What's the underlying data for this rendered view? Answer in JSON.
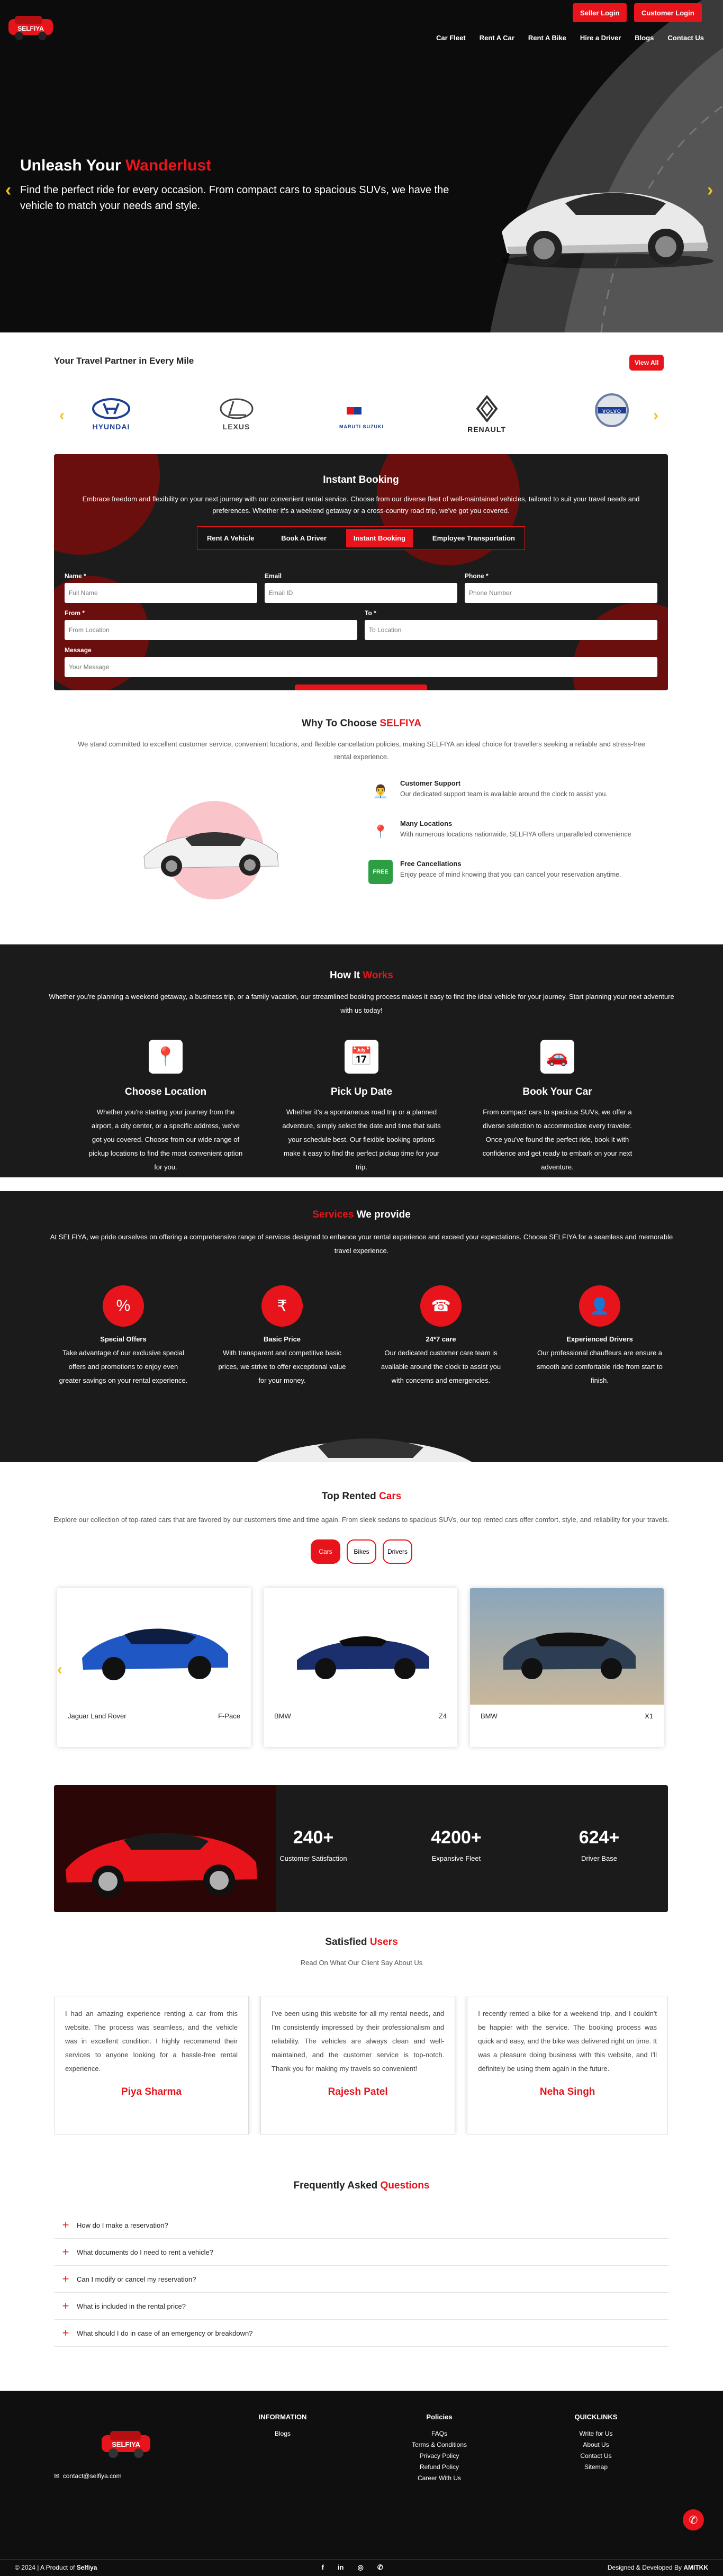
{
  "nav": {
    "seller_login": "Seller Login",
    "customer_login": "Customer Login",
    "links": [
      "Car Fleet",
      "Rent A Car",
      "Rent A Bike",
      "Hire a Driver",
      "Blogs",
      "Contact Us"
    ]
  },
  "hero": {
    "title_white": "Unleash Your",
    "title_red": "Wanderlust",
    "text": "Find the perfect ride for every occasion. From compact cars to spacious SUVs, we have the vehicle to match your needs and style."
  },
  "partners": {
    "title": "Your Travel Partner in Every Mile",
    "view_all": "View All",
    "brands": [
      "HYUNDAI",
      "LEXUS",
      "MARUTI SUZUKI",
      "RENAULT",
      "VOLVO"
    ]
  },
  "booking": {
    "title": "Instant Booking",
    "text": "Embrace freedom and flexibility on your next journey with our convenient rental service. Choose from our diverse fleet of well-maintained vehicles, tailored to suit your travel needs and preferences. Whether it's a weekend getaway or a cross-country road trip, we've got you covered.",
    "tabs": [
      "Rent A Vehicle",
      "Book A Driver",
      "Instant Booking",
      "Employee Transportation"
    ],
    "active_tab": "Instant Booking",
    "fields": {
      "name": {
        "label": "Name *",
        "placeholder": "Full Name"
      },
      "email": {
        "label": "Email",
        "placeholder": "Email ID"
      },
      "phone": {
        "label": "Phone *",
        "placeholder": "Phone Number"
      },
      "from": {
        "label": "From *",
        "placeholder": "From Location"
      },
      "to": {
        "label": "To *",
        "placeholder": "To Location"
      },
      "message": {
        "label": "Message",
        "placeholder": "Your Message"
      }
    },
    "submit": "Submit"
  },
  "why": {
    "title_black": "Why To Choose",
    "title_red": "SELFIYA",
    "text": "We stand committed to excellent customer service, convenient locations, and flexible cancellation policies, making SELFIYA an ideal choice for travellers seeking a reliable and stress-free rental experience.",
    "features": [
      {
        "title": "Customer Support",
        "text": "Our dedicated support team is available around the clock to assist you."
      },
      {
        "title": "Many Locations",
        "text": "With numerous locations nationwide, SELFIYA offers unparalleled convenience"
      },
      {
        "title": "Free Cancellations",
        "text": "Enjoy peace of mind knowing that you can cancel your reservation anytime."
      }
    ]
  },
  "how": {
    "title_white": "How It",
    "title_red": "Works",
    "text": "Whether you're planning a weekend getaway, a business trip, or a family vacation, our streamlined booking process makes it easy to find the ideal vehicle for your journey. Start planning your next adventure with us today!",
    "steps": [
      {
        "title": "Choose Location",
        "text": "Whether you're starting your journey from the airport, a city center, or a specific address, we've got you covered. Choose from our wide range of pickup locations to find the most convenient option for you."
      },
      {
        "title": "Pick Up Date",
        "text": "Whether it's a spontaneous road trip or a planned adventure, simply select the date and time that suits your schedule best. Our flexible booking options make it easy to find the perfect pickup time for your trip."
      },
      {
        "title": "Book Your Car",
        "text": "From compact cars to spacious SUVs, we offer a diverse selection to accommodate every traveler. Once you've found the perfect ride, book it with confidence and get ready to embark on your next adventure."
      }
    ]
  },
  "services": {
    "title_red": "Services",
    "title_white": "We provide",
    "text": "At SELFIYA, we pride ourselves on offering a comprehensive range of services designed to enhance your rental experience and exceed your expectations. Choose SELFIYA for a seamless and memorable travel experience.",
    "items": [
      {
        "title": "Special Offers",
        "text": "Take advantage of our exclusive special offers and promotions to enjoy even greater savings on your rental experience."
      },
      {
        "title": "Basic Price",
        "text": "With transparent and competitive basic prices, we strive to offer exceptional value for your money."
      },
      {
        "title": "24*7 care",
        "text": "Our dedicated customer care team is available around the clock to assist you with concerns and emergencies."
      },
      {
        "title": "Experienced Drivers",
        "text": "Our professional chauffeurs are ensure a smooth and comfortable ride from start to finish."
      }
    ]
  },
  "rented": {
    "title_black": "Top Rented",
    "title_red": "Cars",
    "text": "Explore our collection of top-rated cars that are favored by our customers time and time again. From sleek sedans to spacious SUVs, our top rented cars offer comfort, style, and reliability for your travels.",
    "tabs": [
      "Cars",
      "Bikes",
      "Drivers"
    ],
    "cards": [
      {
        "make": "Jaguar Land Rover",
        "model": "F-Pace"
      },
      {
        "make": "BMW",
        "model": "Z4"
      },
      {
        "make": "BMW",
        "model": "X1"
      }
    ]
  },
  "stats": [
    {
      "num": "240+",
      "label": "Customer Satisfaction"
    },
    {
      "num": "4200+",
      "label": "Expansive Fleet"
    },
    {
      "num": "624+",
      "label": "Driver Base"
    }
  ],
  "testimonials": {
    "title_black": "Satisfied",
    "title_red": "Users",
    "subtitle": "Read On What Our Client Say About Us",
    "items": [
      {
        "text": "I had an amazing experience renting a car from this website. The process was seamless, and the vehicle was in excellent condition. I highly recommend their services to anyone looking for a hassle-free rental experience.",
        "name": "Piya Sharma"
      },
      {
        "text": "I've been using this website for all my rental needs, and I'm consistently impressed by their professionalism and reliability. The vehicles are always clean and well-maintained, and the customer service is top-notch. Thank you for making my travels so convenient!",
        "name": "Rajesh Patel"
      },
      {
        "text": "I recently rented a bike for a weekend trip, and I couldn't be happier with the service. The booking process was quick and easy, and the bike was delivered right on time. It was a pleasure doing business with this website, and I'll definitely be using them again in the future.",
        "name": "Neha Singh"
      }
    ]
  },
  "faq": {
    "title_black": "Frequently Asked",
    "title_red": "Questions",
    "items": [
      "How do I make a reservation?",
      "What documents do I need to rent a vehicle?",
      "Can I modify or cancel my reservation?",
      "What is included in the rental price?",
      "What should I do in case of an emergency or breakdown?"
    ]
  },
  "footer": {
    "email": "contact@selfiya.com",
    "information": {
      "title": "INFORMATION",
      "links": [
        "Blogs"
      ]
    },
    "policies": {
      "title": "Policies",
      "links": [
        "FAQs",
        "Terms & Conditions",
        "Privacy Policy",
        "Refund Policy",
        "Career With Us"
      ]
    },
    "quicklinks": {
      "title": "QUICKLINKS",
      "links": [
        "Write for Us",
        "About Us",
        "Contact Us",
        "Sitemap"
      ]
    },
    "copyright": "© 2024 | A Product of",
    "copyright_brand": "Selfiya",
    "designed": "Designed & Developed By",
    "designed_brand": "AMITKK"
  },
  "colors": {
    "accent": "#e8141b",
    "dark": "#1b1b1b",
    "arrow": "#f2c21b"
  }
}
